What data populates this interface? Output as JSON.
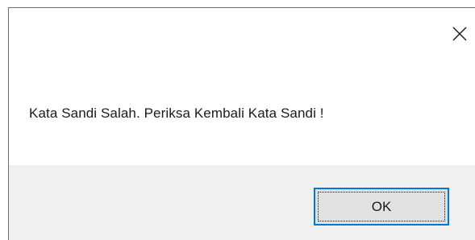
{
  "dialog": {
    "message": "Kata Sandi Salah. Periksa Kembali Kata Sandi !",
    "close_icon": "close-icon",
    "ok_label": "OK",
    "accent_color": "#0078d7",
    "button_area_color": "#f0f0f0"
  }
}
